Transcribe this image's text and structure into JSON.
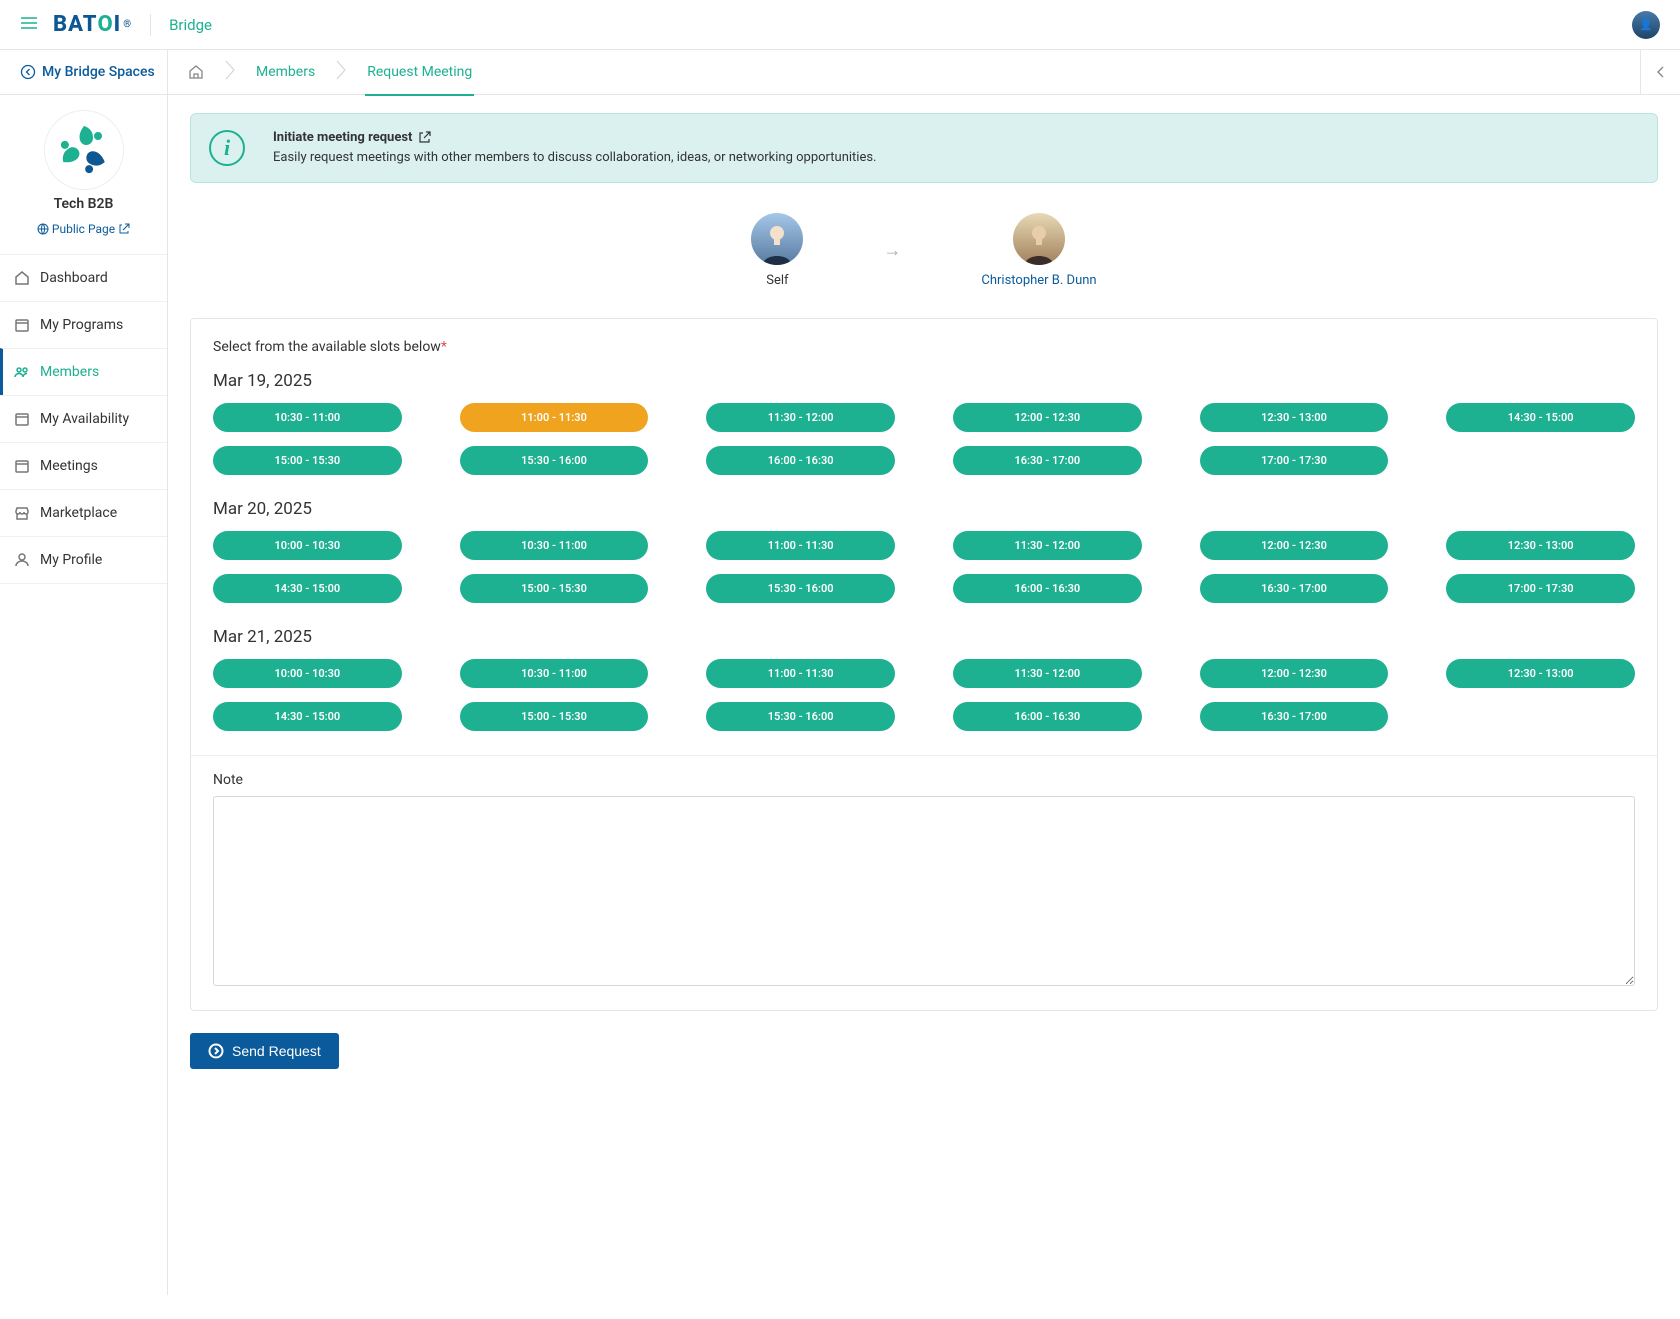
{
  "header": {
    "brand": "BATOI",
    "product": "Bridge"
  },
  "subheader": {
    "back": "My Bridge Spaces"
  },
  "breadcrumbs": {
    "members": "Members",
    "request": "Request Meeting"
  },
  "space": {
    "name": "Tech B2B",
    "public": "Public Page"
  },
  "nav": {
    "dashboard": "Dashboard",
    "programs": "My Programs",
    "members": "Members",
    "availability": "My Availability",
    "meetings": "Meetings",
    "marketplace": "Marketplace",
    "profile": "My Profile"
  },
  "banner": {
    "title": "Initiate meeting request",
    "desc": "Easily request meetings with other members to discuss collaboration, ideas, or networking opportunities."
  },
  "participants": {
    "self": "Self",
    "other": "Christopher B. Dunn"
  },
  "slots": {
    "caption": "Select from the available slots below",
    "days": [
      {
        "date": "Mar 19, 2025",
        "slots": [
          "10:30 - 11:00",
          "11:00 - 11:30",
          "11:30 - 12:00",
          "12:00 - 12:30",
          "12:30 - 13:00",
          "14:30 - 15:00",
          "15:00 - 15:30",
          "15:30 - 16:00",
          "16:00 - 16:30",
          "16:30 - 17:00",
          "17:00 - 17:30"
        ],
        "selected": "11:00 - 11:30"
      },
      {
        "date": "Mar 20, 2025",
        "slots": [
          "10:00 - 10:30",
          "10:30 - 11:00",
          "11:00 - 11:30",
          "11:30 - 12:00",
          "12:00 - 12:30",
          "12:30 - 13:00",
          "14:30 - 15:00",
          "15:00 - 15:30",
          "15:30 - 16:00",
          "16:00 - 16:30",
          "16:30 - 17:00",
          "17:00 - 17:30"
        ]
      },
      {
        "date": "Mar 21, 2025",
        "slots": [
          "10:00 - 10:30",
          "10:30 - 11:00",
          "11:00 - 11:30",
          "11:30 - 12:00",
          "12:00 - 12:30",
          "12:30 - 13:00",
          "14:30 - 15:00",
          "15:00 - 15:30",
          "15:30 - 16:00",
          "16:00 - 16:30",
          "16:30 - 17:00"
        ]
      }
    ]
  },
  "note": {
    "label": "Note"
  },
  "actions": {
    "send": "Send Request"
  }
}
